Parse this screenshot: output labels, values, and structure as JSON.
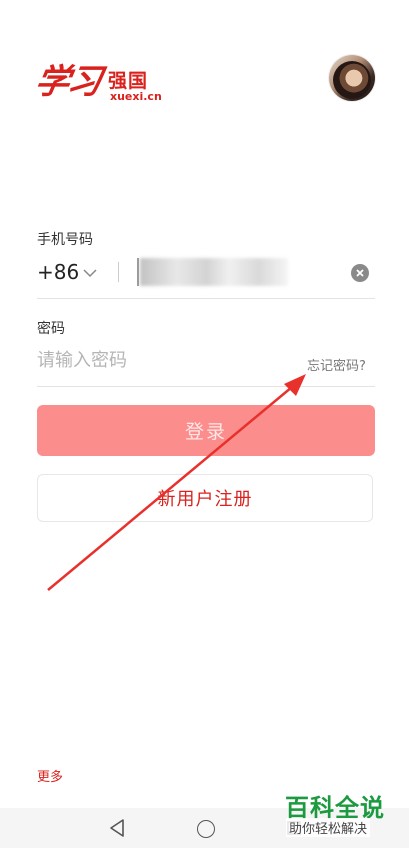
{
  "header": {
    "logo_script": "学习",
    "logo_cn": "强国",
    "logo_en": "xuexi.cn"
  },
  "form": {
    "phone_label": "手机号码",
    "country_code": "+86",
    "password_label": "密码",
    "password_placeholder": "请输入密码",
    "forgot_link": "忘记密码?",
    "login_button": "登录",
    "register_button": "新用户注册"
  },
  "footer": {
    "more_link": "更多"
  },
  "watermark": {
    "title": "百科全说",
    "subtitle": "助你轻松解决"
  },
  "icons": {
    "country_dropdown": "chevron-down-icon",
    "clear": "close-circle-icon",
    "nav_back": "triangle-back-icon",
    "nav_home": "circle-home-icon",
    "nav_recent": "square-recent-icon"
  },
  "colors": {
    "brand_red": "#d9221e",
    "login_button_bg": "#fb8e8c",
    "annotation_arrow": "#e8302c",
    "watermark_green": "#1c9a3f"
  }
}
